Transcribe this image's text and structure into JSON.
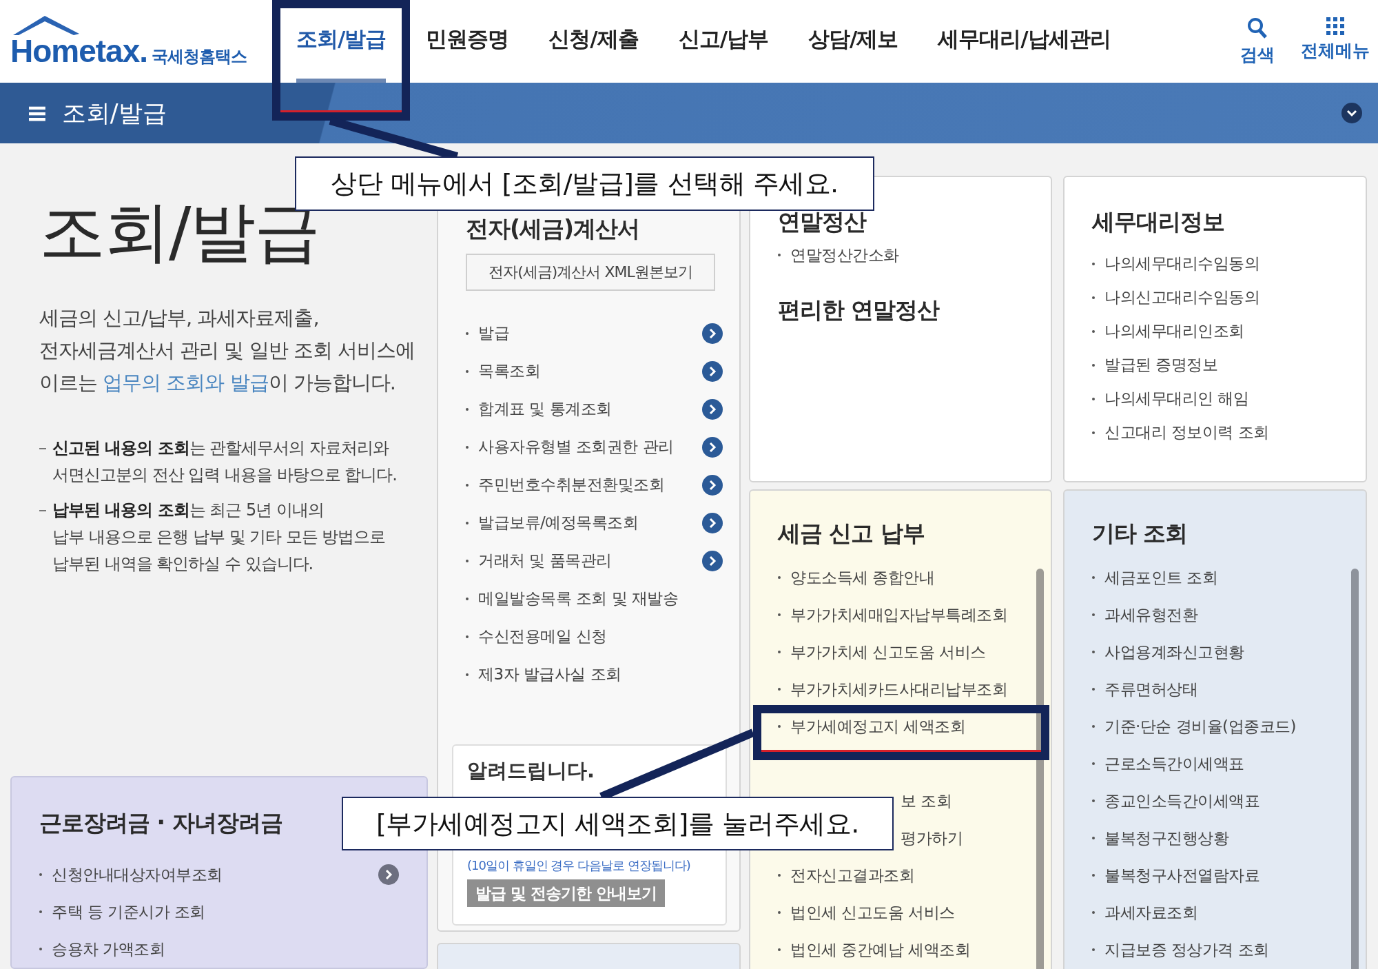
{
  "header": {
    "logo": {
      "wordmark": "Hometax.",
      "subtitle": "국세청홈택스"
    },
    "nav": [
      {
        "label": "조회/발급",
        "selected": true,
        "highlighted": true
      },
      {
        "label": "민원증명",
        "selected": false,
        "highlighted": false
      },
      {
        "label": "신청/제출",
        "selected": false,
        "highlighted": false
      },
      {
        "label": "신고/납부",
        "selected": false,
        "highlighted": false
      },
      {
        "label": "상담/제보",
        "selected": false,
        "highlighted": false
      },
      {
        "label": "세무대리/납세관리",
        "selected": false,
        "highlighted": false
      }
    ],
    "tools": [
      {
        "kind": "search",
        "label": "검색"
      },
      {
        "kind": "menu",
        "label": "전체메뉴"
      }
    ]
  },
  "section_bar": {
    "menu_glyph": "≡",
    "title": "조회/발급"
  },
  "intro": {
    "title": "조회/발급",
    "description": [
      [
        {
          "text": "세금의 신고/납부, 과세자료제출,"
        }
      ],
      [
        {
          "text": "전자세금계산서 관리 및 일반 조회 서비스에"
        }
      ],
      [
        {
          "text": "이르는 "
        },
        {
          "text": "업무의 조회와 발급",
          "kind": "link"
        },
        {
          "text": "이 가능합니다."
        }
      ]
    ],
    "notes": [
      [
        "**신고된 내용의 조회**는 관할세무서의 자료처리와",
        "서면신고분의 전산 입력 내용을 바탕으로 합니다."
      ],
      [
        "**납부된 내용의 조회**는 최근 5년 이내의",
        "납부 내용으로 은행 납부 및 기타 모든 방법으로",
        "납부된 내역을 확인하실 수 있습니다."
      ]
    ]
  },
  "tax_invoice": {
    "title": "전자(세금)계산서",
    "color": "#f8f8f8",
    "button": "전자(세금)계산서 XML원본보기",
    "items": [
      {
        "label": "발급",
        "arrow": true
      },
      {
        "label": "목록조회",
        "arrow": true
      },
      {
        "label": "합계표 및 통계조회",
        "arrow": true
      },
      {
        "label": "사용자유형별 조회권한 관리",
        "arrow": true
      },
      {
        "label": "주민번호수취분전환및조회",
        "arrow": true
      },
      {
        "label": "발급보류/예정목록조회",
        "arrow": true
      },
      {
        "label": "거래처 및 품목관리",
        "arrow": true
      },
      {
        "label": "메일발송목록 조회 및 재발송",
        "arrow": false
      },
      {
        "label": "수신전용메일 신청",
        "arrow": false
      },
      {
        "label": "제3자 발급사실 조회",
        "arrow": false
      }
    ],
    "notice": {
      "title": "알려드립니다.",
      "text": "(10일이 휴일인 경우 다음날로 연장됩니다)",
      "button": "발급 및 전송기한 안내보기"
    }
  },
  "year_end": {
    "title": "연말정산",
    "color": "#ffffff",
    "items": [
      {
        "label": "연말정산간소화"
      }
    ],
    "subtitle": "편리한 연말정산"
  },
  "tax_agent": {
    "title": "세무대리정보",
    "color": "#ffffff",
    "items": [
      {
        "label": "나의세무대리수임동의"
      },
      {
        "label": "나의신고대리수임동의"
      },
      {
        "label": "나의세무대리인조회"
      },
      {
        "label": "발급된 증명정보"
      },
      {
        "label": "나의세무대리인 해임"
      },
      {
        "label": "신고대리 정보이력 조회"
      }
    ]
  },
  "tax_filing": {
    "title": "세금 신고 납부",
    "color": "#fcfaea",
    "items": [
      {
        "label": "양도소득세 종합안내",
        "kind": "link",
        "highlighted": false
      },
      {
        "label": "부가가치세매입자납부특례조회",
        "kind": "link",
        "highlighted": false
      },
      {
        "label": "부가가치세 신고도움 서비스",
        "kind": "link",
        "highlighted": false
      },
      {
        "label": "부가가치세카드사대리납부조회",
        "kind": "link",
        "highlighted": false
      },
      {
        "label": "부가세예정고지 세액조회",
        "kind": "link",
        "highlighted": true
      },
      {
        "label": "보 조회",
        "kind": "clipped",
        "highlighted": false
      },
      {
        "label": "평가하기",
        "kind": "clipped",
        "highlighted": false
      },
      {
        "label": "전자신고결과조회",
        "kind": "link",
        "highlighted": false
      },
      {
        "label": "법인세 신고도움 서비스",
        "kind": "link",
        "highlighted": false
      },
      {
        "label": "법인세 중간예납 세액조회",
        "kind": "link",
        "highlighted": false
      }
    ]
  },
  "other_inquiry": {
    "title": "기타 조회",
    "color": "#e3eaf3",
    "items": [
      {
        "label": "세금포인트 조회"
      },
      {
        "label": "과세유형전환"
      },
      {
        "label": "사업용계좌신고현황"
      },
      {
        "label": "주류면허상태"
      },
      {
        "label": "기준·단순 경비율(업종코드)"
      },
      {
        "label": "근로소득간이세액표"
      },
      {
        "label": "종교인소득간이세액표"
      },
      {
        "label": "불복청구진행상황"
      },
      {
        "label": "불복청구사전열람자료"
      },
      {
        "label": "과세자료조회"
      },
      {
        "label": "지급보증 정상가격 조회"
      }
    ]
  },
  "incentive": {
    "title": "근로장려금 · 자녀장려금",
    "color": "#dddcf2",
    "items": [
      {
        "label": "신청안내대상자여부조회",
        "arrow": true
      },
      {
        "label": "주택 등 기준시가 조회",
        "arrow": false
      },
      {
        "label": "승용차 가액조회",
        "arrow": false
      }
    ]
  },
  "annotations": [
    {
      "text": "상단 메뉴에서 [조회/발급]를 선택해 주세요."
    },
    {
      "text": "[부가세예정고지 세액조회]를 눌러주세요."
    }
  ]
}
